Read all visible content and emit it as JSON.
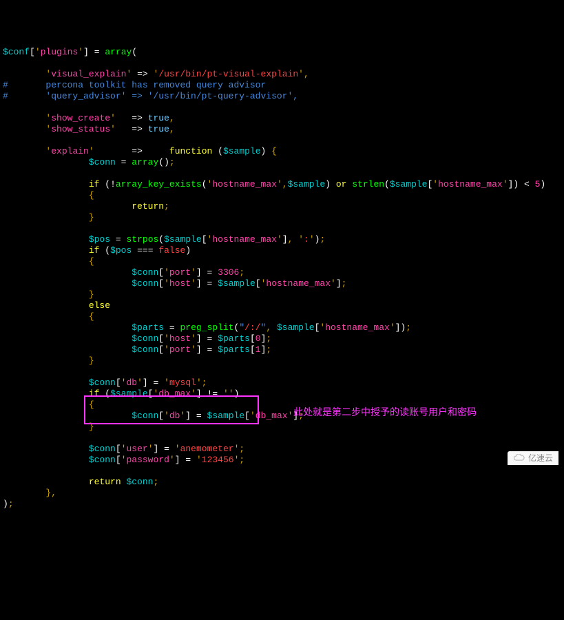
{
  "code": {
    "l1": {
      "conf": "$conf",
      "plugins": "plugins",
      "array": "array"
    },
    "l2": {
      "key": "visual_explain",
      "val": "/usr/bin/pt-visual-explain"
    },
    "l3": "#       percona toolkit has removed query advisor",
    "l4": "#       'query_advisor' => '/usr/bin/pt-query-advisor',",
    "l5": {
      "key": "show_create",
      "val": "true"
    },
    "l6": {
      "key": "show_status",
      "val": "true"
    },
    "l7": {
      "key": "explain",
      "fn": "function",
      "sample": "$sample"
    },
    "l8": {
      "conn": "$conn",
      "array": "array"
    },
    "l9": {
      "ake": "array_key_exists",
      "hn": "hostname_max",
      "sample": "$sample",
      "or": "or",
      "strlen": "strlen",
      "lt": "<",
      "five": "5"
    },
    "l10": "return",
    "l11": {
      "pos": "$pos",
      "strpos": "strpos",
      "sample": "$sample",
      "hn": "hostname_max",
      "colon": ":"
    },
    "l12": {
      "pos": "$pos",
      "false": "false"
    },
    "l13": {
      "conn": "$conn",
      "port": "port",
      "n": "3306"
    },
    "l14": {
      "conn": "$conn",
      "host": "host",
      "sample": "$sample",
      "hn": "hostname_max"
    },
    "l15": "else",
    "l16": {
      "parts": "$parts",
      "ps": "preg_split",
      "re": "/:/",
      "sample": "$sample",
      "hn": "hostname_max"
    },
    "l17": {
      "conn": "$conn",
      "host": "host",
      "parts": "$parts",
      "i": "0"
    },
    "l18": {
      "conn": "$conn",
      "port": "port",
      "parts": "$parts",
      "i": "1"
    },
    "l19": {
      "conn": "$conn",
      "db": "db",
      "mysql": "mysql"
    },
    "l20": {
      "sample": "$sample",
      "dbmax": "db_max"
    },
    "l21": {
      "conn": "$conn",
      "db": "db",
      "sample": "$sample",
      "dbmax": "db_max"
    },
    "l22": {
      "conn": "$conn",
      "user": "user",
      "val": "anemometer"
    },
    "l23": {
      "conn": "$conn",
      "pw": "password",
      "val": "123456"
    },
    "l24": {
      "ret": "return",
      "conn": "$conn"
    }
  },
  "annotation": "此处就是第二步中授予的读账号用户和密码",
  "watermark": "亿速云"
}
